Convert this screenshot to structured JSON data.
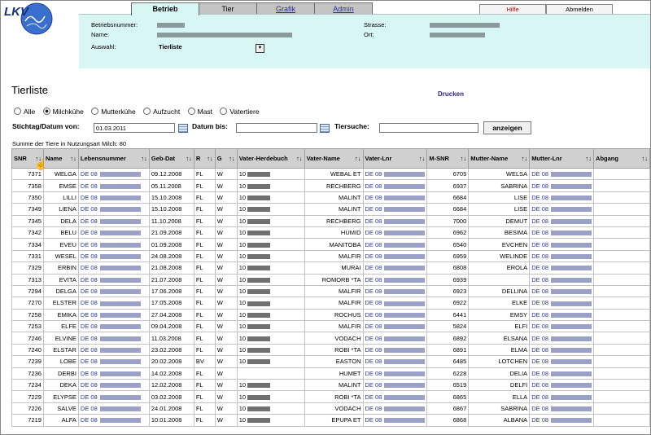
{
  "logo": {
    "text": "LKV"
  },
  "tabs": [
    {
      "label": "Betrieb",
      "active": true,
      "link": false
    },
    {
      "label": "Tier",
      "active": false,
      "link": false
    },
    {
      "label": "Grafik",
      "active": false,
      "link": true
    },
    {
      "label": "Admin",
      "active": false,
      "link": true
    }
  ],
  "top_buttons": {
    "hilfe": "Hilfe",
    "abmelden": "Abmelden"
  },
  "header": {
    "betriebsnummer_label": "Betriebsnummer:",
    "name_label": "Name:",
    "strasse_label": "Strasse:",
    "ort_label": "Ort:",
    "auswahl_label": "Auswahl:",
    "auswahl_value": "Tierliste"
  },
  "page_title": "Tierliste",
  "drucken": "Drucken",
  "radios": [
    {
      "label": "Alle",
      "checked": false
    },
    {
      "label": "Milchkühe",
      "checked": true
    },
    {
      "label": "Mutterkühe",
      "checked": false
    },
    {
      "label": "Aufzucht",
      "checked": false
    },
    {
      "label": "Mast",
      "checked": false
    },
    {
      "label": "Vatertiere",
      "checked": false
    }
  ],
  "filters": {
    "stichtag_label": "Stichtag/Datum von:",
    "stichtag_value": "01.03.2011",
    "datum_bis_label": "Datum bis:",
    "datum_bis_value": "",
    "tiersuche_label": "Tiersuche:",
    "tiersuche_value": "",
    "anzeigen": "anzeigen"
  },
  "summe": "Summe der Tiere in Nutzungsart Milch: 80",
  "columns": [
    "SNR",
    "Name",
    "Lebensnummer",
    "Geb-Dat",
    "R",
    "G",
    "Vater-Herdebuch",
    "Vater-Name",
    "Vater-Lnr",
    "M-SNR",
    "Mutter-Name",
    "Mutter-Lnr",
    "Abgang"
  ],
  "sort_arrows": "↑↓",
  "rows": [
    {
      "snr": "7371",
      "name": "WELGA",
      "leb": "DE 08",
      "geb": "09.12.2008",
      "r": "FL",
      "g": "W",
      "vhb": "10",
      "vname": "WEBAL ET",
      "vlnr": "DE 08",
      "msnr": "6705",
      "mname": "WELSA",
      "mlnr": "DE 08",
      "abgang": ""
    },
    {
      "snr": "7358",
      "name": "EMSE",
      "leb": "DE 08",
      "geb": "05.11.2008",
      "r": "FL",
      "g": "W",
      "vhb": "10",
      "vname": "RECHBERG",
      "vlnr": "DE 08",
      "msnr": "6937",
      "mname": "SABRINA",
      "mlnr": "DE 08",
      "abgang": ""
    },
    {
      "snr": "7350",
      "name": "LILLI",
      "leb": "DE 08",
      "geb": "15.10.2008",
      "r": "FL",
      "g": "W",
      "vhb": "10",
      "vname": "MALINT",
      "vlnr": "DE 08",
      "msnr": "6684",
      "mname": "LISE",
      "mlnr": "DE 08",
      "abgang": ""
    },
    {
      "snr": "7349",
      "name": "LIENA",
      "leb": "DE 08",
      "geb": "15.10.2008",
      "r": "FL",
      "g": "W",
      "vhb": "10",
      "vname": "MALINT",
      "vlnr": "DE 08",
      "msnr": "6684",
      "mname": "LISE",
      "mlnr": "DE 08",
      "abgang": ""
    },
    {
      "snr": "7345",
      "name": "DELA",
      "leb": "DE 08",
      "geb": "11.10.2008",
      "r": "FL",
      "g": "W",
      "vhb": "10",
      "vname": "RECHBERG",
      "vlnr": "DE 08",
      "msnr": "7000",
      "mname": "DEMUT",
      "mlnr": "DE 08",
      "abgang": ""
    },
    {
      "snr": "7342",
      "name": "BELU",
      "leb": "DE 08",
      "geb": "21.09.2008",
      "r": "FL",
      "g": "W",
      "vhb": "10",
      "vname": "HUMID",
      "vlnr": "DE 08",
      "msnr": "6962",
      "mname": "BESIMA",
      "mlnr": "DE 08",
      "abgang": ""
    },
    {
      "snr": "7334",
      "name": "EVEU",
      "leb": "DE 08",
      "geb": "01.09.2008",
      "r": "FL",
      "g": "W",
      "vhb": "10",
      "vname": "MANITOBA",
      "vlnr": "DE 08",
      "msnr": "6540",
      "mname": "EVCHEN",
      "mlnr": "DE 08",
      "abgang": ""
    },
    {
      "snr": "7331",
      "name": "WESEL",
      "leb": "DE 08",
      "geb": "24.08.2008",
      "r": "FL",
      "g": "W",
      "vhb": "10",
      "vname": "MALFIR",
      "vlnr": "DE 08",
      "msnr": "6959",
      "mname": "WELINDE",
      "mlnr": "DE 08",
      "abgang": ""
    },
    {
      "snr": "7329",
      "name": "ERBIN",
      "leb": "DE 08",
      "geb": "21.08.2008",
      "r": "FL",
      "g": "W",
      "vhb": "10",
      "vname": "MURAI",
      "vlnr": "DE 08",
      "msnr": "6808",
      "mname": "EROLA",
      "mlnr": "DE 08",
      "abgang": ""
    },
    {
      "snr": "7313",
      "name": "EVITA",
      "leb": "DE 08",
      "geb": "21.07.2008",
      "r": "FL",
      "g": "W",
      "vhb": "10",
      "vname": "ROMORB *TA",
      "vlnr": "DE 08",
      "msnr": "6939",
      "mname": "",
      "mlnr": "DE 08",
      "abgang": ""
    },
    {
      "snr": "7294",
      "name": "DELGA",
      "leb": "DE 08",
      "geb": "17.06.2008",
      "r": "FL",
      "g": "W",
      "vhb": "10",
      "vname": "MALFIR",
      "vlnr": "DE 08",
      "msnr": "6923",
      "mname": "DELLINA",
      "mlnr": "DE 08",
      "abgang": ""
    },
    {
      "snr": "7270",
      "name": "ELSTER",
      "leb": "DE 08",
      "geb": "17.05.2008",
      "r": "FL",
      "g": "W",
      "vhb": "10",
      "vname": "MALFIR",
      "vlnr": "DE 08",
      "msnr": "6922",
      "mname": "ELKE",
      "mlnr": "DE 08",
      "abgang": ""
    },
    {
      "snr": "7258",
      "name": "EMIKA",
      "leb": "DE 08",
      "geb": "27.04.2008",
      "r": "FL",
      "g": "W",
      "vhb": "10",
      "vname": "ROCHUS",
      "vlnr": "DE 08",
      "msnr": "6441",
      "mname": "EMSY",
      "mlnr": "DE 08",
      "abgang": ""
    },
    {
      "snr": "7253",
      "name": "ELFE",
      "leb": "DE 08",
      "geb": "09.04.2008",
      "r": "FL",
      "g": "W",
      "vhb": "10",
      "vname": "MALFIR",
      "vlnr": "DE 08",
      "msnr": "5824",
      "mname": "ELFI",
      "mlnr": "DE 08",
      "abgang": ""
    },
    {
      "snr": "7246",
      "name": "ELVINE",
      "leb": "DE 08",
      "geb": "11.03.2008",
      "r": "FL",
      "g": "W",
      "vhb": "10",
      "vname": "VODACH",
      "vlnr": "DE 08",
      "msnr": "6892",
      "mname": "ELSANA",
      "mlnr": "DE 08",
      "abgang": ""
    },
    {
      "snr": "7240",
      "name": "ELSTAR",
      "leb": "DE 08",
      "geb": "23.02.2008",
      "r": "FL",
      "g": "W",
      "vhb": "10",
      "vname": "ROBI *TA",
      "vlnr": "DE 08",
      "msnr": "6891",
      "mname": "ELMA",
      "mlnr": "DE 08",
      "abgang": ""
    },
    {
      "snr": "7239",
      "name": "LOBE",
      "leb": "DE 08",
      "geb": "20.02.2008",
      "r": "BV",
      "g": "W",
      "vhb": "10",
      "vname": "EASTON",
      "vlnr": "DE 08",
      "msnr": "6485",
      "mname": "LOTCHEN",
      "mlnr": "DE 08",
      "abgang": ""
    },
    {
      "snr": "7236",
      "name": "DERBI",
      "leb": "DE 08",
      "geb": "14.02.2008",
      "r": "FL",
      "g": "W",
      "vhb": "",
      "vname": "HUMET",
      "vlnr": "DE 08",
      "msnr": "6228",
      "mname": "DELIA",
      "mlnr": "DE 08",
      "abgang": ""
    },
    {
      "snr": "7234",
      "name": "DEKA",
      "leb": "DE 08",
      "geb": "12.02.2008",
      "r": "FL",
      "g": "W",
      "vhb": "10",
      "vname": "MALINT",
      "vlnr": "DE 08",
      "msnr": "6519",
      "mname": "DELFI",
      "mlnr": "DE 08",
      "abgang": ""
    },
    {
      "snr": "7229",
      "name": "ELYPSE",
      "leb": "DE 08",
      "geb": "03.02.2008",
      "r": "FL",
      "g": "W",
      "vhb": "10",
      "vname": "ROBI *TA",
      "vlnr": "DE 08",
      "msnr": "6865",
      "mname": "ELLA",
      "mlnr": "DE 08",
      "abgang": ""
    },
    {
      "snr": "7226",
      "name": "SALVE",
      "leb": "DE 08",
      "geb": "24.01.2008",
      "r": "FL",
      "g": "W",
      "vhb": "10",
      "vname": "VODACH",
      "vlnr": "DE 08",
      "msnr": "6867",
      "mname": "SABRINA",
      "mlnr": "DE 08",
      "abgang": ""
    },
    {
      "snr": "7219",
      "name": "ALFA",
      "leb": "DE 08",
      "geb": "10.01.2008",
      "r": "FL",
      "g": "W",
      "vhb": "10",
      "vname": "EPUPA ET",
      "vlnr": "DE 08",
      "msnr": "6868",
      "mname": "ALBANA",
      "mlnr": "DE 08",
      "abgang": ""
    }
  ]
}
